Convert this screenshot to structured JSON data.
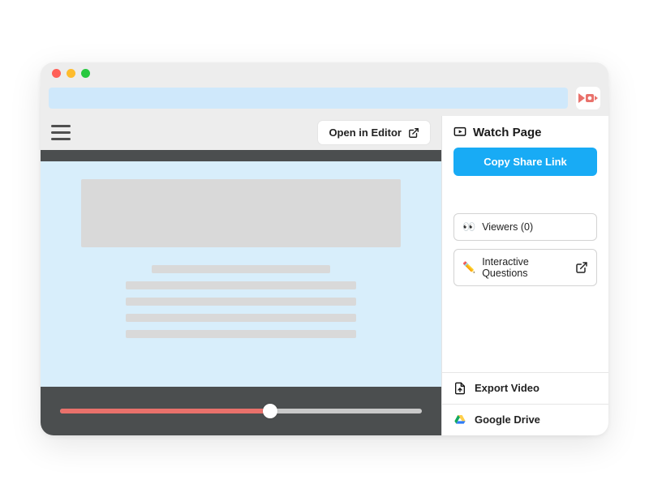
{
  "toolbar": {
    "open_in_editor": "Open in Editor"
  },
  "panel": {
    "title": "Watch Page",
    "copy_share_link": "Copy Share Link",
    "viewers_label": "Viewers (0)",
    "viewers_emoji": "👀",
    "interactive_label": "Interactive Questions",
    "interactive_emoji": "✏️",
    "export_video": "Export Video",
    "google_drive": "Google Drive"
  },
  "video": {
    "progress_percent": 58
  },
  "icons": {
    "extension": "screencast-ext-icon",
    "open_external": "open-external-icon",
    "watch_page": "play-in-monitor-icon",
    "file_export": "file-export-icon",
    "drive": "google-drive-icon"
  }
}
